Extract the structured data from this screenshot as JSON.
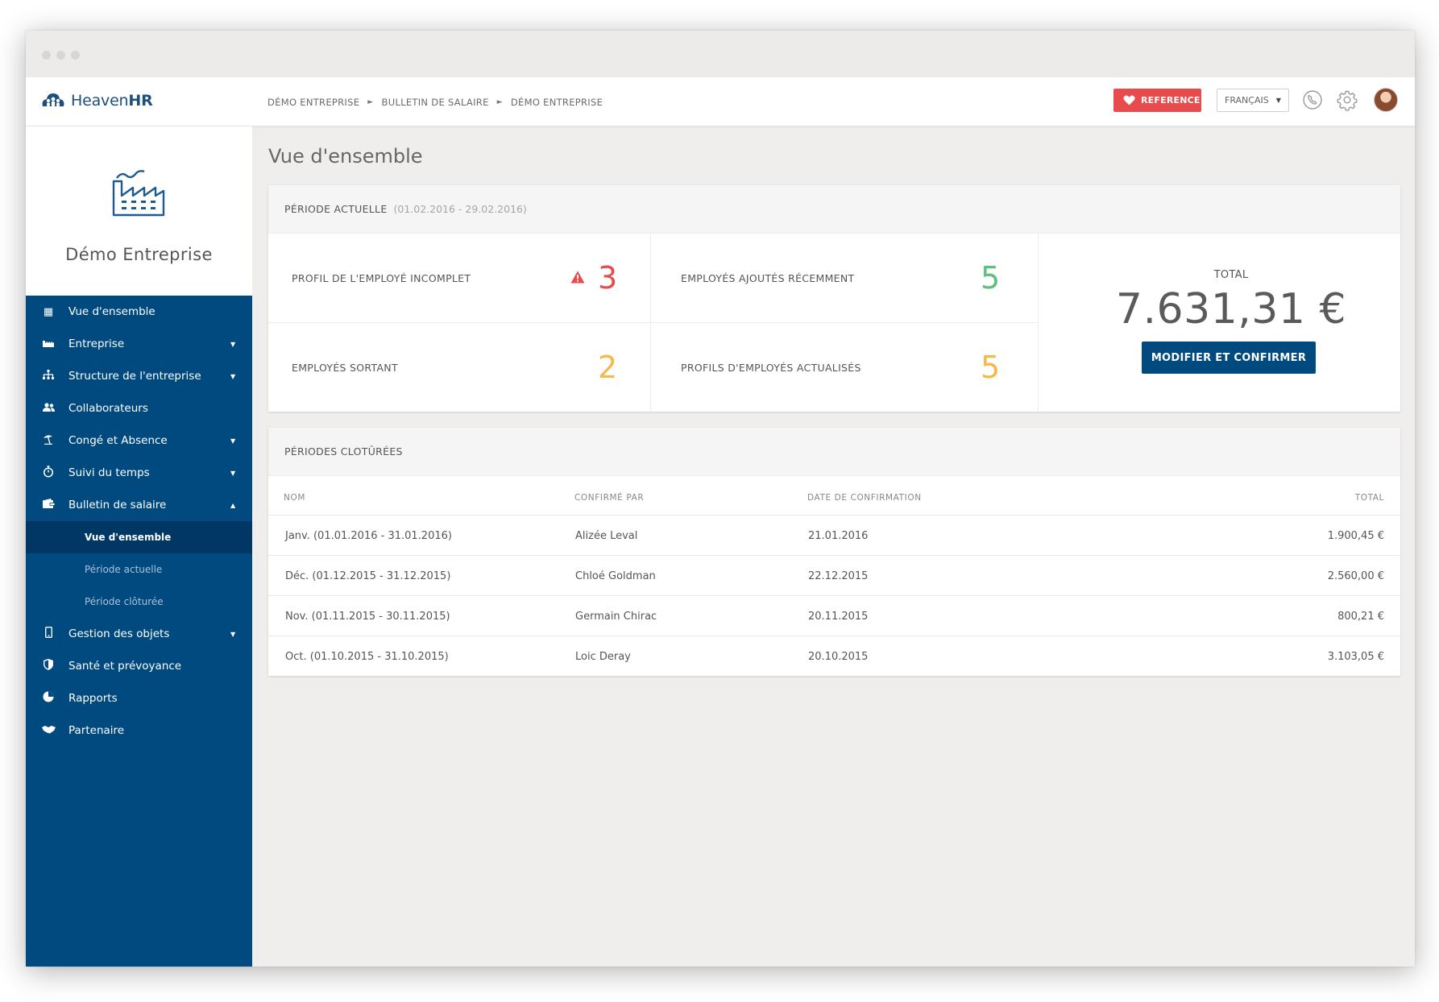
{
  "topbar": {
    "logo_text_plain": "Heaven",
    "logo_text_bold": "HR",
    "breadcrumbs": [
      "DÉMO ENTREPRISE",
      "BULLETIN DE SALAIRE",
      "DÉMO ENTREPRISE"
    ],
    "reference_label": "REFERENCE",
    "language": "FRANÇAIS"
  },
  "sidebar": {
    "company_name": "Démo Entreprise",
    "items": [
      {
        "label": "Vue d'ensemble",
        "icon": "dashboard-icon"
      },
      {
        "label": "Entreprise",
        "icon": "factory-icon"
      },
      {
        "label": "Structure de l'entreprise",
        "icon": "org-chart-icon"
      },
      {
        "label": "Collaborateurs",
        "icon": "users-icon"
      },
      {
        "label": "Congé et Absence",
        "icon": "beach-icon"
      },
      {
        "label": "Suivi du temps",
        "icon": "stopwatch-icon"
      },
      {
        "label": "Bulletin de salaire",
        "icon": "wallet-icon"
      },
      {
        "label": "Gestion des objets",
        "icon": "phone-icon"
      },
      {
        "label": "Santé et prévoyance",
        "icon": "shield-icon"
      },
      {
        "label": "Rapports",
        "icon": "pie-chart-icon"
      },
      {
        "label": "Partenaire",
        "icon": "handshake-icon"
      }
    ],
    "sub_items": [
      "Vue d'ensemble",
      "Période actuelle",
      "Période clôturée"
    ]
  },
  "page": {
    "title": "Vue d'ensemble"
  },
  "current_period": {
    "title": "PÉRIODE ACTUELLE",
    "range": "(01.02.2016 - 29.02.2016)",
    "stats": [
      {
        "label": "PROFIL DE L'EMPLOYÉ INCOMPLET",
        "value": "3",
        "color": "#e84b4b"
      },
      {
        "label": "EMPLOYÉS AJOUTÉS RÉCEMMENT",
        "value": "5",
        "color": "#5fbf7e"
      },
      {
        "label": "EMPLOYÉS SORTANT",
        "value": "2",
        "color": "#f5b84a"
      },
      {
        "label": "PROFILS D'EMPLOYÉS ACTUALISÉS",
        "value": "5",
        "color": "#f5b84a"
      }
    ],
    "total_label": "TOTAL",
    "total_value": "7.631,31 €",
    "confirm_label": "MODIFIER ET CONFIRMER"
  },
  "closed_periods": {
    "title": "PÉRIODES CLOTÛRÉES",
    "columns": [
      "NOM",
      "CONFIRMÉ PAR",
      "DATE DE CONFIRMATION",
      "TOTAL"
    ],
    "rows": [
      [
        "Janv. (01.01.2016 - 31.01.2016)",
        "Alizée Leval",
        "21.01.2016",
        "1.900,45 €"
      ],
      [
        "Déc. (01.12.2015 - 31.12.2015)",
        "Chloé Goldman",
        "22.12.2015",
        "2.560,00 €"
      ],
      [
        "Nov. (01.11.2015 - 30.11.2015)",
        "Germain Chirac",
        "20.11.2015",
        "800,21 €"
      ],
      [
        "Oct. (01.10.2015 - 31.10.2015)",
        "Loic Deray",
        "20.10.2015",
        "3.103,05 €"
      ]
    ]
  },
  "colors": {
    "brand": "#004a80",
    "danger": "#e84b4b",
    "success": "#5fbf7e",
    "warning": "#f5b84a"
  }
}
